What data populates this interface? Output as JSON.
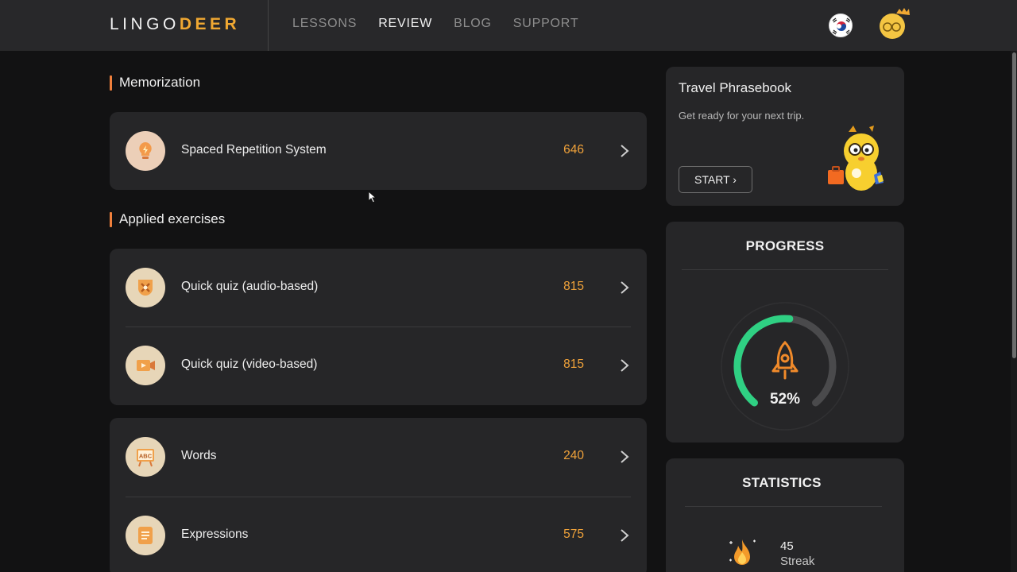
{
  "brand": {
    "part1": "LINGO",
    "part2": "DEER"
  },
  "nav": [
    {
      "label": "LESSONS",
      "active": false
    },
    {
      "label": "REVIEW",
      "active": true
    },
    {
      "label": "BLOG",
      "active": false
    },
    {
      "label": "SUPPORT",
      "active": false
    }
  ],
  "sections": {
    "memorization": "Memorization",
    "applied": "Applied exercises"
  },
  "items": {
    "srs": {
      "label": "Spaced Repetition System",
      "count": "646",
      "icon": "lightbulb-icon"
    },
    "quiz_audio": {
      "label": "Quick quiz (audio-based)",
      "count": "815",
      "icon": "shield-icon"
    },
    "quiz_video": {
      "label": "Quick quiz (video-based)",
      "count": "815",
      "icon": "video-icon"
    },
    "words": {
      "label": "Words",
      "count": "240",
      "icon": "abc-board-icon"
    },
    "expressions": {
      "label": "Expressions",
      "count": "575",
      "icon": "document-icon"
    }
  },
  "travel": {
    "title": "Travel Phrasebook",
    "subtitle": "Get ready for your next trip.",
    "start": "START ›"
  },
  "progress": {
    "title": "PROGRESS",
    "percent": 52,
    "percent_label": "52%"
  },
  "statistics": {
    "title": "STATISTICS",
    "streak_value": "45",
    "streak_label": "Streak"
  },
  "colors": {
    "accent": "#f0a23a",
    "progress": "#2fd083",
    "panel": "#262628"
  }
}
